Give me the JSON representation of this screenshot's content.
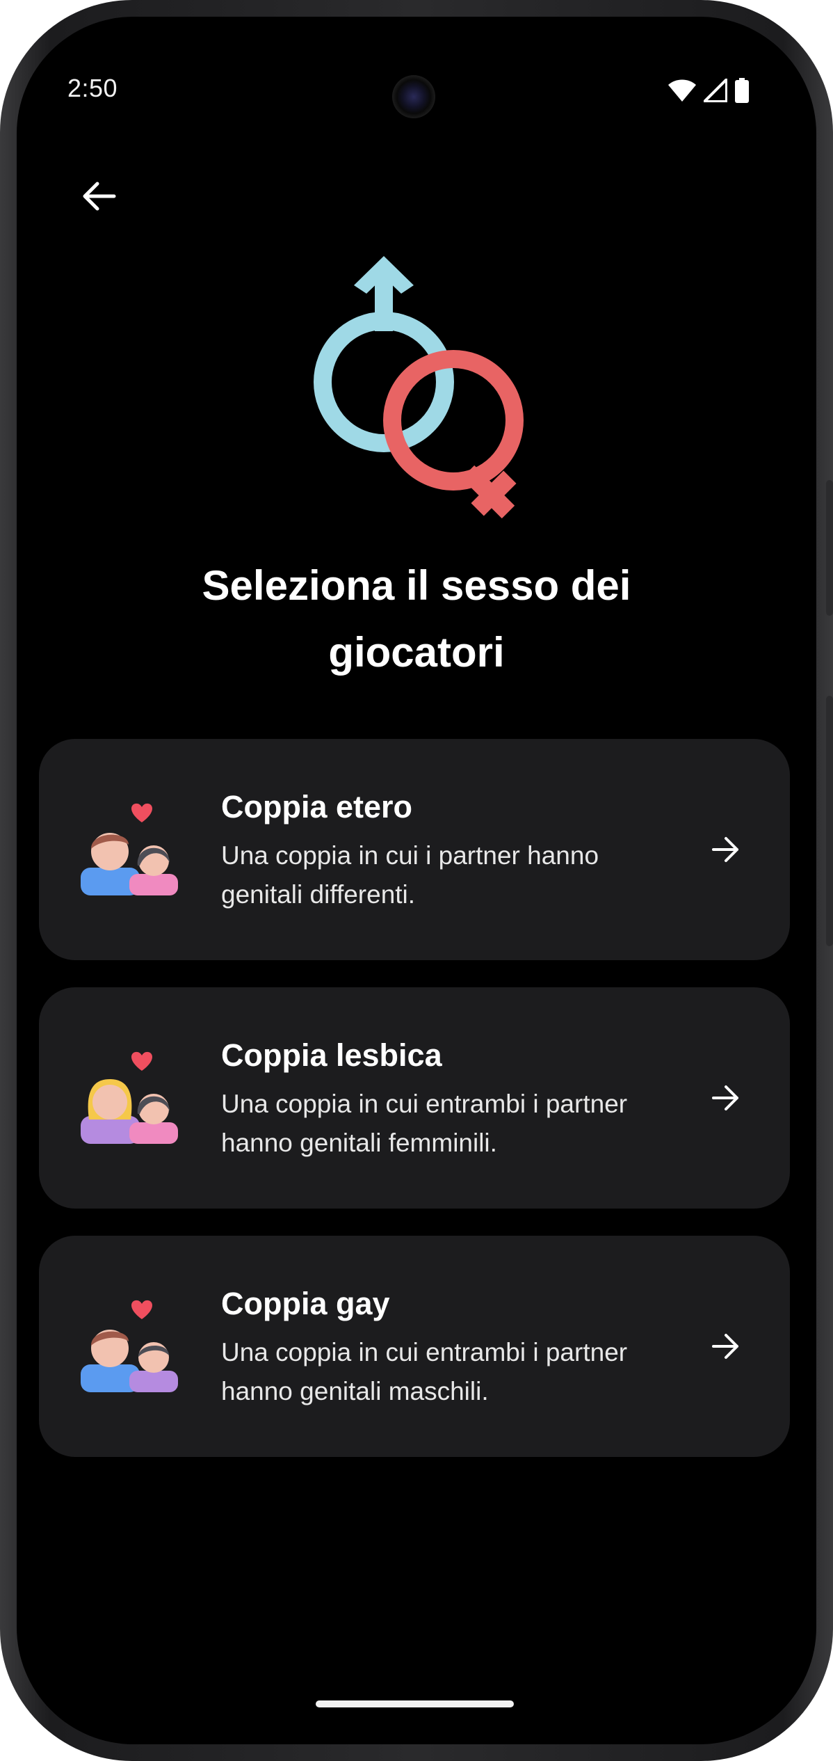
{
  "status_bar": {
    "time": "2:50",
    "icons": [
      "wifi-icon",
      "cell-signal-icon",
      "battery-icon"
    ]
  },
  "header": {
    "back_icon": "arrow-left-icon",
    "hero_icon": "gender-symbols-icon"
  },
  "title": {
    "line1": "Seleziona il sesso dei",
    "line2": "giocatori"
  },
  "options": [
    {
      "title": "Coppia etero",
      "desc_line1": "Una coppia in cui i partner hanno",
      "desc_line2": "genitali differenti.",
      "icon": "straight-couple-icon"
    },
    {
      "title": "Coppia lesbica",
      "desc_line1": "Una coppia in cui entrambi i partner",
      "desc_line2": "hanno genitali femminili.",
      "icon": "lesbian-couple-icon"
    },
    {
      "title": "Coppia gay",
      "desc_line1": "Una coppia in cui entrambi i partner",
      "desc_line2": "hanno genitali maschili.",
      "icon": "gay-couple-icon"
    }
  ],
  "colors": {
    "background": "#000000",
    "card": "#1c1c1e",
    "male_symbol": "#9fd9e6",
    "female_symbol": "#e86464",
    "heart": "#ef4f5f"
  }
}
